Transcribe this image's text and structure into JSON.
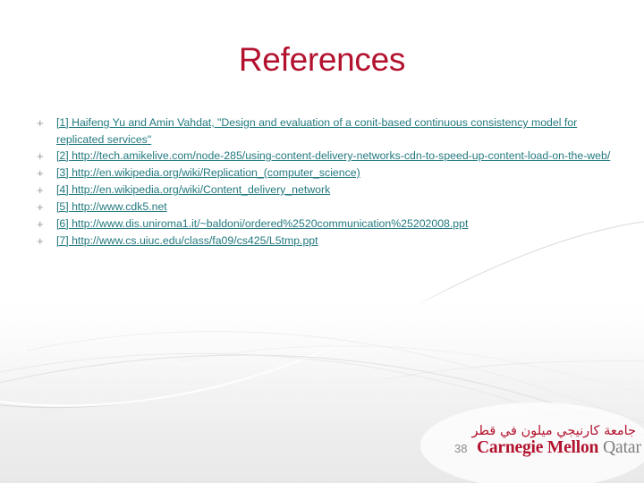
{
  "slide": {
    "title": "References",
    "title_color": "#b3122e",
    "link_color": "#22797f",
    "bullet_glyph": "+",
    "page_number": "38"
  },
  "references": [
    {
      "bullet": "+",
      "text": "[1] Haifeng Yu and Amin Vahdat, \"Design and evaluation of a conit-based continuous consistency model for replicated services\""
    },
    {
      "bullet": "+",
      "text": "[2] http://tech.amikelive.com/node-285/using-content-delivery-networks-cdn-to-speed-up-content-load-on-the-web/"
    },
    {
      "bullet": "+",
      "text": "[3] http://en.wikipedia.org/wiki/Replication_(computer_science)"
    },
    {
      "bullet": "+",
      "text": "[4] http://en.wikipedia.org/wiki/Content_delivery_network"
    },
    {
      "bullet": "+",
      "text": "[5] http://www.cdk5.net"
    },
    {
      "bullet": "+",
      "text": "[6] http://www.dis.uniroma1.it/~baldoni/ordered%2520communication%25202008.ppt"
    },
    {
      "bullet": "+",
      "text": "[7] http://www.cs.uiuc.edu/class/fa09/cs425/L5tmp.ppt"
    }
  ],
  "logo": {
    "arabic": "جامعة كارنيجي ميلون في قطر",
    "carnegie_mellon": "Carnegie Mellon",
    "qatar": "Qatar",
    "red": "#b3122e",
    "gray": "#7e7e7e"
  }
}
